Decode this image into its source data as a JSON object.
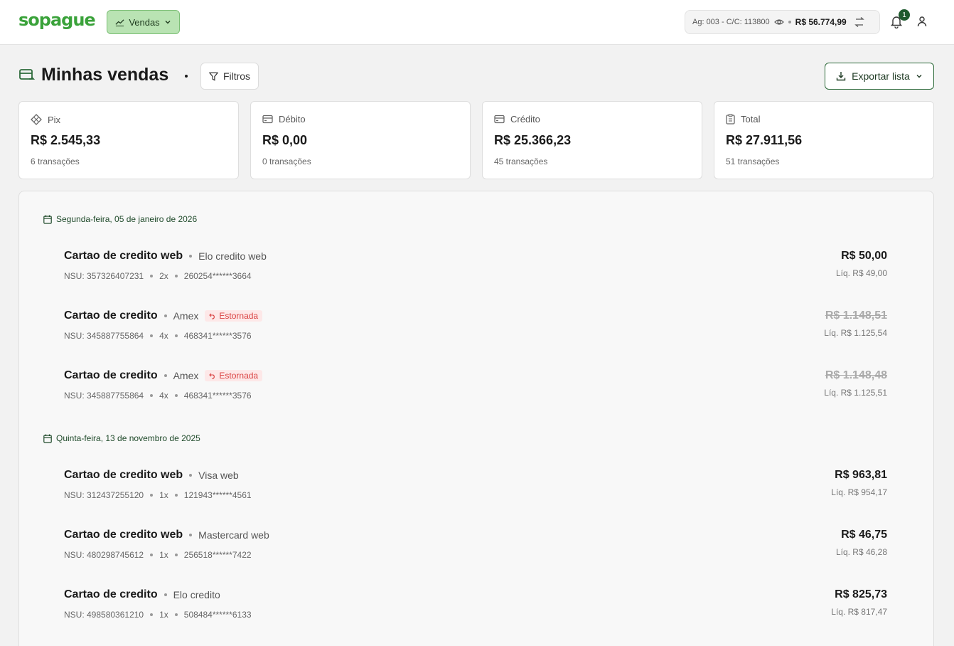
{
  "header": {
    "logo": "sopague",
    "nav_button": "Vendas",
    "account": "Ag: 003 - C/C: 113800",
    "balance": "R$ 56.774,99",
    "notification_count": "1"
  },
  "page": {
    "title": "Minhas vendas",
    "filters_label": "Filtros",
    "export_label": "Exportar lista"
  },
  "summary": [
    {
      "label": "Pix",
      "value": "R$ 2.545,33",
      "count": "6 transações",
      "icon": "pix-icon"
    },
    {
      "label": "Débito",
      "value": "R$ 0,00",
      "count": "0 transações",
      "icon": "card-icon"
    },
    {
      "label": "Crédito",
      "value": "R$ 25.366,23",
      "count": "45 transações",
      "icon": "card-icon"
    },
    {
      "label": "Total",
      "value": "R$ 27.911,56",
      "count": "51 transações",
      "icon": "clipboard-icon"
    }
  ],
  "groups": [
    {
      "date": "Segunda-feira, 05 de janeiro de 2026",
      "transactions": [
        {
          "name": "Cartao de credito web",
          "brand": "Elo credito web",
          "status": "",
          "nsu": "NSU: 357326407231",
          "installments": "2x",
          "card": "260254******3664",
          "amount": "R$ 50,00",
          "net": "Líq. R$ 49,00",
          "reversed": false
        },
        {
          "name": "Cartao de credito",
          "brand": "Amex",
          "status": "Estornada",
          "nsu": "NSU: 345887755864",
          "installments": "4x",
          "card": "468341******3576",
          "amount": "R$ 1.148,51",
          "net": "Líq. R$ 1.125,54",
          "reversed": true
        },
        {
          "name": "Cartao de credito",
          "brand": "Amex",
          "status": "Estornada",
          "nsu": "NSU: 345887755864",
          "installments": "4x",
          "card": "468341******3576",
          "amount": "R$ 1.148,48",
          "net": "Líq. R$ 1.125,51",
          "reversed": true
        }
      ]
    },
    {
      "date": "Quinta-feira, 13 de novembro de 2025",
      "transactions": [
        {
          "name": "Cartao de credito web",
          "brand": "Visa web",
          "status": "",
          "nsu": "NSU: 312437255120",
          "installments": "1x",
          "card": "121943******4561",
          "amount": "R$ 963,81",
          "net": "Líq. R$ 954,17",
          "reversed": false
        },
        {
          "name": "Cartao de credito web",
          "brand": "Mastercard web",
          "status": "",
          "nsu": "NSU: 480298745612",
          "installments": "1x",
          "card": "256518******7422",
          "amount": "R$ 46,75",
          "net": "Líq. R$ 46,28",
          "reversed": false
        },
        {
          "name": "Cartao de credito",
          "brand": "Elo credito",
          "status": "",
          "nsu": "NSU: 498580361210",
          "installments": "1x",
          "card": "508484******6133",
          "amount": "R$ 825,73",
          "net": "Líq. R$ 817,47",
          "reversed": false
        }
      ]
    }
  ],
  "colors": {
    "brand_green": "#3aa23a",
    "dark_green": "#1e5a2e",
    "reversed_red": "#d94141"
  }
}
